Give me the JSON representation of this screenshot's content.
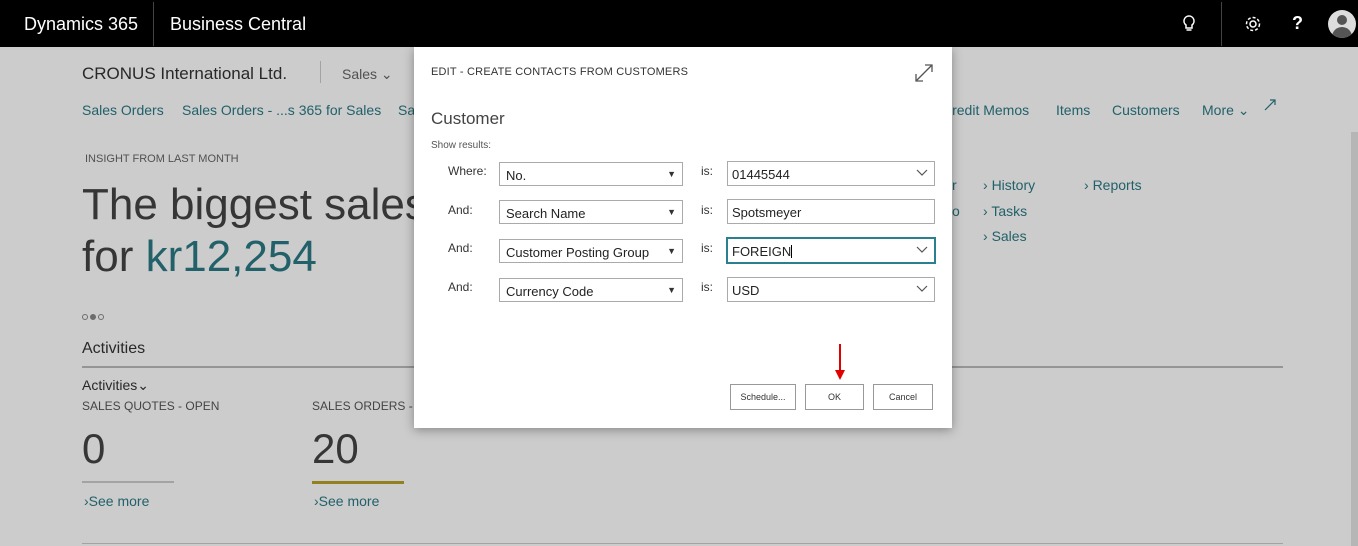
{
  "topbar": {
    "brand": "Dynamics 365",
    "app": "Business Central",
    "help": "?",
    "icons": [
      "lightbulb-icon",
      "gear-icon",
      "help-icon",
      "avatar"
    ]
  },
  "page": {
    "company": "CRONUS International Ltd.",
    "sales_menu": "Sales",
    "nav": {
      "sales_orders": "Sales Orders",
      "sales_orders_365": "Sales Orders - ...s 365 for Sales",
      "sa": "Sa",
      "credit_memos": "Credit Memos",
      "items": "Items",
      "customers": "Customers",
      "more": "More"
    },
    "insight_label": "INSIGHT FROM LAST MONTH",
    "headline_line1": "The biggest sales",
    "headline_prefix": "for ",
    "headline_amount": "kr12,254",
    "activities_title": "Activities",
    "activities_sub": "Activities",
    "tiles": [
      {
        "caption": "SALES QUOTES - OPEN",
        "value": "0",
        "see_more": "See more"
      },
      {
        "caption": "SALES ORDERS - O",
        "value": "20",
        "see_more": "See more"
      }
    ],
    "action_links": {
      "r": "r",
      "o": "o",
      "history": "History",
      "tasks": "Tasks",
      "sales": "Sales",
      "reports": "Reports"
    }
  },
  "dialog": {
    "title": "EDIT - CREATE CONTACTS FROM CUSTOMERS",
    "section": "Customer",
    "show_results": "Show results:",
    "is_label": "is:",
    "rows": [
      {
        "label": "Where:",
        "field": "No.",
        "value": "01445544"
      },
      {
        "label": "And:",
        "field": "Search Name",
        "value": "Spotsmeyer"
      },
      {
        "label": "And:",
        "field": "Customer Posting Group",
        "value": "FOREIGN"
      },
      {
        "label": "And:",
        "field": "Currency Code",
        "value": "USD"
      }
    ],
    "buttons": {
      "schedule": "Schedule...",
      "ok": "OK",
      "cancel": "Cancel"
    }
  },
  "colors": {
    "accent": "#2b7a85",
    "annotation_arrow": "#e00000",
    "tile_highlight": "#b8a028"
  }
}
